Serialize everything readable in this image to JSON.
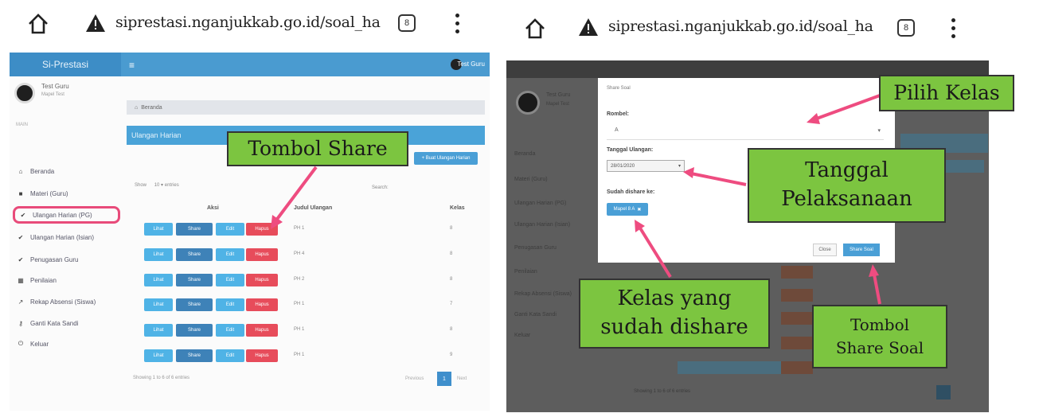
{
  "url": "siprestasi.nganjukkab.go.id/soal_ha",
  "tabs_count": "8",
  "colors": {
    "accent": "#4a9bd0",
    "callout": "#7cc540",
    "arrow": "#ee4c80",
    "danger": "#e74c5b"
  },
  "left": {
    "app_brand": "Si-Prestasi",
    "top_user": "Test Guru",
    "user": {
      "name": "Test Guru",
      "role": "Mapel Test"
    },
    "nav_section": "MAIN",
    "sidebar": [
      {
        "icon": "home-icon",
        "glyph": "⌂",
        "label": "Beranda"
      },
      {
        "icon": "folder-icon",
        "glyph": "■",
        "label": "Materi (Guru)"
      },
      {
        "icon": "check-icon",
        "glyph": "✔",
        "label": "Ulangan Harian (PG)",
        "active": true
      },
      {
        "icon": "check-icon",
        "glyph": "✔",
        "label": "Ulangan Harian (Isian)"
      },
      {
        "icon": "check-icon",
        "glyph": "✔",
        "label": "Penugasan Guru"
      },
      {
        "icon": "grid-icon",
        "glyph": "▦",
        "label": "Penilaian"
      },
      {
        "icon": "chart-icon",
        "glyph": "↗",
        "label": "Rekap Absensi (Siswa)"
      },
      {
        "icon": "key-icon",
        "glyph": "⚷",
        "label": "Ganti Kata Sandi"
      },
      {
        "icon": "power-icon",
        "glyph": "⏻",
        "label": "Keluar"
      }
    ],
    "breadcrumb": "Beranda",
    "page_title": "Ulangan Harian",
    "add_button": "+ Buat Ulangan Harian",
    "show_label": "Show",
    "show_value": "10",
    "entries_label": "entries",
    "search_label": "Search:",
    "columns": {
      "aksi": "Aksi",
      "judul": "Judul Ulangan",
      "kelas": "Kelas"
    },
    "row_buttons": {
      "lihat": "Lihat",
      "share": "Share",
      "edit": "Edit",
      "hapus": "Hapus"
    },
    "rows": [
      {
        "judul": "PH 1",
        "kelas": "8"
      },
      {
        "judul": "PH 4",
        "kelas": "8"
      },
      {
        "judul": "PH 2",
        "kelas": "8"
      },
      {
        "judul": "PH 1",
        "kelas": "7"
      },
      {
        "judul": "PH 1",
        "kelas": "8"
      },
      {
        "judul": "PH 1",
        "kelas": "9"
      }
    ],
    "showing": "Showing 1 to 6 of 6 entries",
    "prev": "Previous",
    "page": "1",
    "next": "Next",
    "callout_share": "Tombol Share"
  },
  "right": {
    "modal_title": "Share Soal",
    "rombel_label": "Rombel:",
    "rombel_value": "A",
    "date_label": "Tanggal Ulangan:",
    "date_value": "28/01/2020",
    "shared_label": "Sudah dishare ke:",
    "shared_chip": "Mapel 8 A",
    "close_button": "Close",
    "share_button": "Share Soal",
    "bg_user_name": "Test Guru",
    "bg_user_role": "Mapel Test",
    "bg_sidebar": [
      "Beranda",
      "Materi (Guru)",
      "Ulangan Harian (PG)",
      "Ulangan Harian (Isian)",
      "Penugasan Guru",
      "Penilaian",
      "Rekap Absensi (Siswa)",
      "Ganti Kata Sandi",
      "Keluar"
    ],
    "bg_showing": "Showing 1 to 6 of 6 entries",
    "callouts": {
      "pilih_kelas": "Pilih Kelas",
      "tanggal_line1": "Tanggal",
      "tanggal_line2": "Pelaksanaan",
      "kelas_line1": "Kelas yang",
      "kelas_line2": "sudah dishare",
      "tombol_line1": "Tombol",
      "tombol_line2": "Share Soal"
    }
  }
}
